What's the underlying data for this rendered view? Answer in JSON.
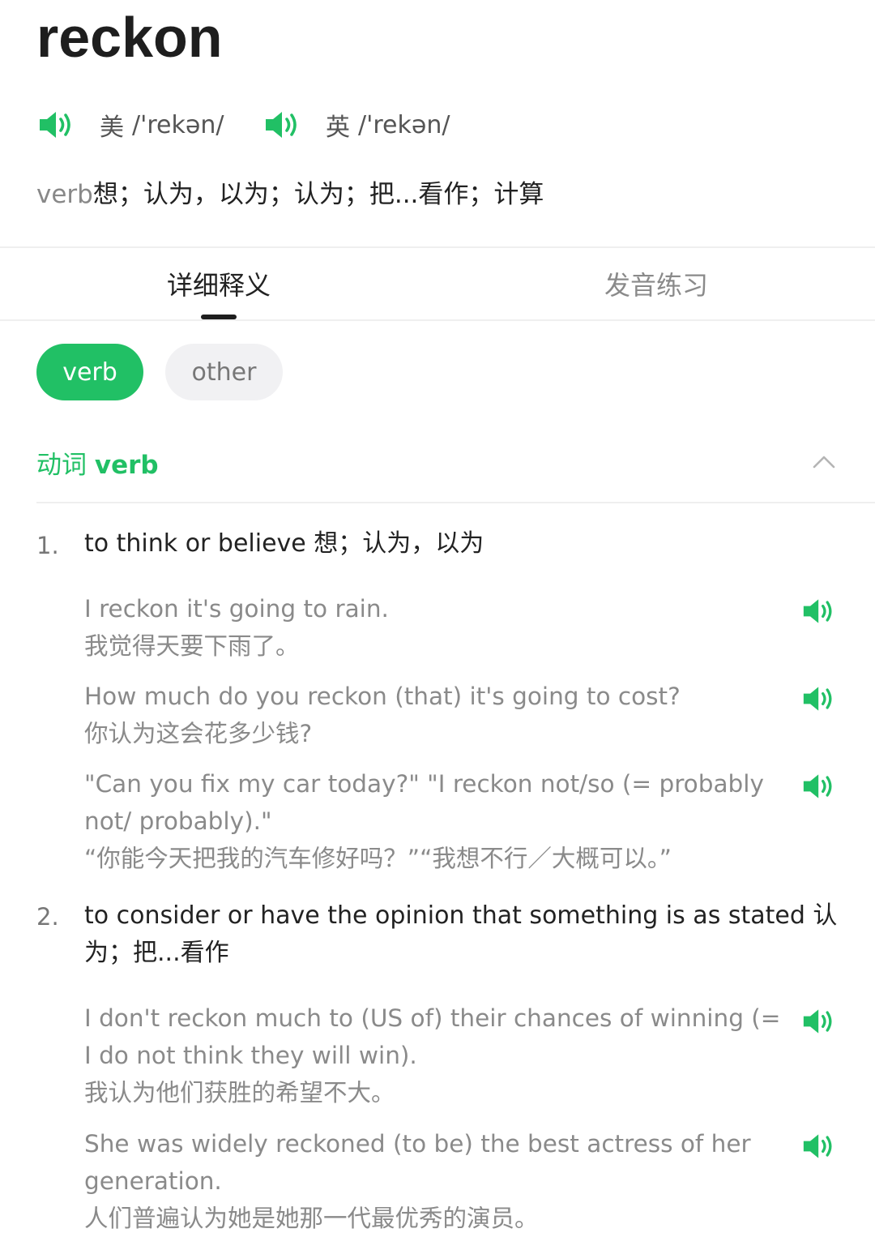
{
  "headword": "reckon",
  "pronunciations": [
    {
      "region": "美",
      "ipa": "/'rekən/"
    },
    {
      "region": "英",
      "ipa": "/'rekən/"
    }
  ],
  "brief": {
    "pos": "verb",
    "meaning": "想；认为，以为；认为；把...看作；计算"
  },
  "tabs": [
    {
      "label": "详细释义",
      "active": true
    },
    {
      "label": "发音练习",
      "active": false
    }
  ],
  "chips": [
    {
      "label": "verb",
      "selected": true
    },
    {
      "label": "other",
      "selected": false
    }
  ],
  "section": {
    "cn": "动词",
    "en": "verb"
  },
  "senses": [
    {
      "num": "1.",
      "def": "to think or believe 想；认为，以为",
      "examples": [
        {
          "en": "I reckon it's going to rain.",
          "cn": "我觉得天要下雨了。"
        },
        {
          "en": "How much do you reckon (that) it's going to cost?",
          "cn": "你认为这会花多少钱?"
        },
        {
          "en": "\"Can you fix my car today?\" \"I reckon not/so (= probably not/ probably).\"",
          "cn": "“你能今天把我的汽车修好吗？”“我想不行／大概可以。”"
        }
      ]
    },
    {
      "num": "2.",
      "def": "to consider or have the opinion that something is as stated 认为；把...看作",
      "examples": [
        {
          "en": "I don't reckon much to (US of) their chances of winning (= I do not think they will win).",
          "cn": "我认为他们获胜的希望不大。"
        },
        {
          "en": "She was widely reckoned (to be) the best actress of her generation.",
          "cn": "人们普遍认为她是她那一代最优秀的演员。"
        }
      ]
    }
  ],
  "colors": {
    "accent": "#21c065",
    "muted": "#8a8a8a",
    "text": "#222222"
  }
}
